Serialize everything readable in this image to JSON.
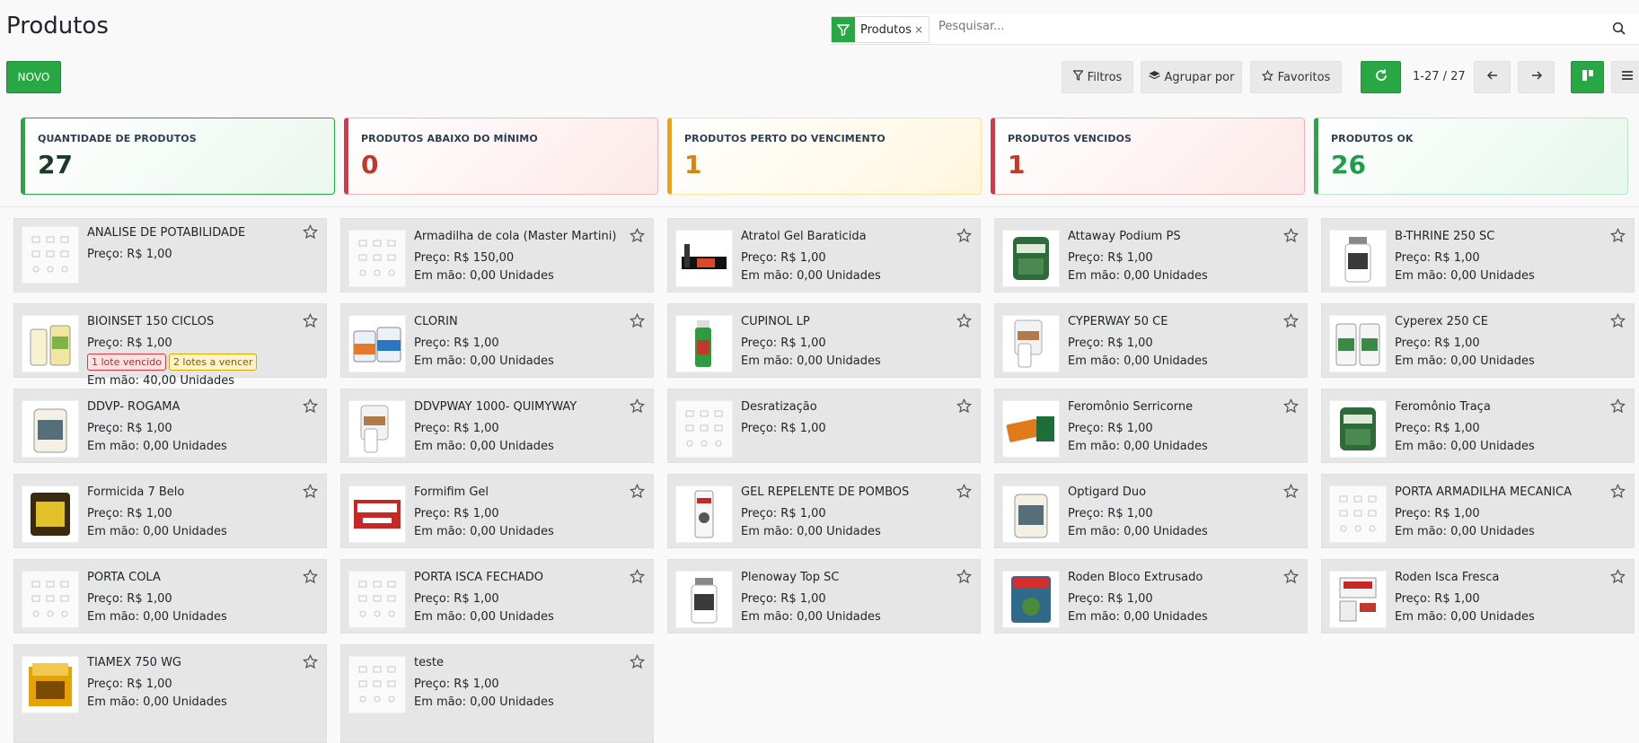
{
  "page": {
    "title": "Produtos"
  },
  "search": {
    "facet_label": "Produtos",
    "facet_remove": "×",
    "placeholder": "Pesquisar..."
  },
  "toolbar": {
    "new_label": "NOVO",
    "filters_label": "Filtros",
    "group_label": "Agrupar por",
    "favorites_label": "Favoritos",
    "pager": "1-27 / 27"
  },
  "icons": {
    "facet": "filter-icon",
    "search": "search-icon",
    "filters": "filter-icon",
    "group": "layers-icon",
    "favorites": "star-icon",
    "refresh": "refresh-icon",
    "prev": "arrow-left-icon",
    "next": "arrow-right-icon",
    "kanban": "kanban-view-icon",
    "list": "list-view-icon",
    "card_star": "star-icon"
  },
  "colors": {
    "primary": "#28a745",
    "danger": "#dc3545",
    "warning": "#f0a500"
  },
  "kpis": [
    {
      "label": "QUANTIDADE DE PRODUTOS",
      "value": "27",
      "tone": "blue"
    },
    {
      "label": "PRODUTOS ABAIXO DO MÍNIMO",
      "value": "0",
      "tone": "red"
    },
    {
      "label": "PRODUTOS PERTO DO VENCIMENTO",
      "value": "1",
      "tone": "yellow"
    },
    {
      "label": "PRODUTOS VENCIDOS",
      "value": "1",
      "tone": "red"
    },
    {
      "label": "PRODUTOS OK",
      "value": "26",
      "tone": "green"
    }
  ],
  "products": [
    {
      "name": "ANALISE DE POTABILIDADE",
      "price": "Preço: R$ 1,00",
      "stock": "",
      "image": "placeholder"
    },
    {
      "name": "Armadilha de cola (Master Martini)",
      "price": "Preço: R$ 150,00",
      "stock": "Em mão: 0,00 Unidades",
      "image": "placeholder"
    },
    {
      "name": "Atratol Gel Baraticida",
      "price": "Preço: R$ 1,00",
      "stock": "Em mão: 0,00 Unidades",
      "image": "gel-box"
    },
    {
      "name": "Attaway Podium PS",
      "price": "Preço: R$ 1,00",
      "stock": "Em mão: 0,00 Unidades",
      "image": "green-bag"
    },
    {
      "name": "B-THRINE 250 SC",
      "price": "Preço: R$ 1,00",
      "stock": "Em mão: 0,00 Unidades",
      "image": "white-bottle"
    },
    {
      "name": "BIOINSET 150 CICLOS",
      "price": "Preço: R$ 1,00",
      "stock": "Em mão: 40,00 Unidades",
      "image": "bottles-yellow",
      "badges": [
        "1 lote vencido",
        "2 lotes a vencer"
      ]
    },
    {
      "name": "CLORIN",
      "price": "Preço: R$ 1,00",
      "stock": "Em mão: 0,00 Unidades",
      "image": "tubs"
    },
    {
      "name": "CUPINOL LP",
      "price": "Preço: R$ 1,00",
      "stock": "Em mão: 0,00 Unidades",
      "image": "green-spray"
    },
    {
      "name": "CYPERWAY 50 CE",
      "price": "Preço: R$ 1,00",
      "stock": "Em mão: 0,00 Unidades",
      "image": "white-bottles"
    },
    {
      "name": "Cyperex 250 CE",
      "price": "Preço: R$ 1,00",
      "stock": "Em mão: 0,00 Unidades",
      "image": "green-bottles"
    },
    {
      "name": "DDVP- ROGAMA",
      "price": "Preço: R$ 1,00",
      "stock": "Em mão: 0,00 Unidades",
      "image": "jug"
    },
    {
      "name": "DDVPWAY 1000- QUIMYWAY",
      "price": "Preço: R$ 1,00",
      "stock": "Em mão: 0,00 Unidades",
      "image": "white-bottles"
    },
    {
      "name": "Desratização",
      "price": "Preço: R$ 1,00",
      "stock": "",
      "image": "placeholder"
    },
    {
      "name": "Feromônio Serricorne",
      "price": "Preço: R$ 1,00",
      "stock": "Em mão: 0,00 Unidades",
      "image": "trap"
    },
    {
      "name": "Feromônio Traça",
      "price": "Preço: R$ 1,00",
      "stock": "Em mão: 0,00 Unidades",
      "image": "green-bag"
    },
    {
      "name": "Formicida 7 Belo",
      "price": "Preço: R$ 1,00",
      "stock": "Em mão: 0,00 Unidades",
      "image": "yellow-bag"
    },
    {
      "name": "Formifim Gel",
      "price": "Preço: R$ 1,00",
      "stock": "Em mão: 0,00 Unidades",
      "image": "red-box"
    },
    {
      "name": "GEL REPELENTE DE POMBOS",
      "price": "Preço: R$ 1,00",
      "stock": "Em mão: 0,00 Unidades",
      "image": "tube"
    },
    {
      "name": "Optigard Duo",
      "price": "Preço: R$ 1,00",
      "stock": "Em mão: 0,00 Unidades",
      "image": "jug"
    },
    {
      "name": "PORTA ARMADILHA MECANICA",
      "price": "Preço: R$ 1,00",
      "stock": "Em mão: 0,00 Unidades",
      "image": "placeholder"
    },
    {
      "name": "PORTA COLA",
      "price": "Preço: R$ 1,00",
      "stock": "Em mão: 0,00 Unidades",
      "image": "placeholder"
    },
    {
      "name": "PORTA ISCA FECHADO",
      "price": "Preço: R$ 1,00",
      "stock": "Em mão: 0,00 Unidades",
      "image": "placeholder"
    },
    {
      "name": "Plenoway Top SC",
      "price": "Preço: R$ 1,00",
      "stock": "Em mão: 0,00 Unidades",
      "image": "white-bottle"
    },
    {
      "name": "Roden Bloco Extrusado",
      "price": "Preço: R$ 1,00",
      "stock": "Em mão: 0,00 Unidades",
      "image": "red-bag"
    },
    {
      "name": "Roden Isca Fresca",
      "price": "Preço: R$ 1,00",
      "stock": "Em mão: 0,00 Unidades",
      "image": "packets"
    },
    {
      "name": "TIAMEX 750 WG",
      "price": "Preço: R$ 1,00",
      "stock": "Em mão: 0,00 Unidades",
      "image": "yellow-box"
    },
    {
      "name": "teste",
      "price": "Preço: R$ 1,00",
      "stock": "Em mão: 0,00 Unidades",
      "image": "placeholder"
    }
  ]
}
